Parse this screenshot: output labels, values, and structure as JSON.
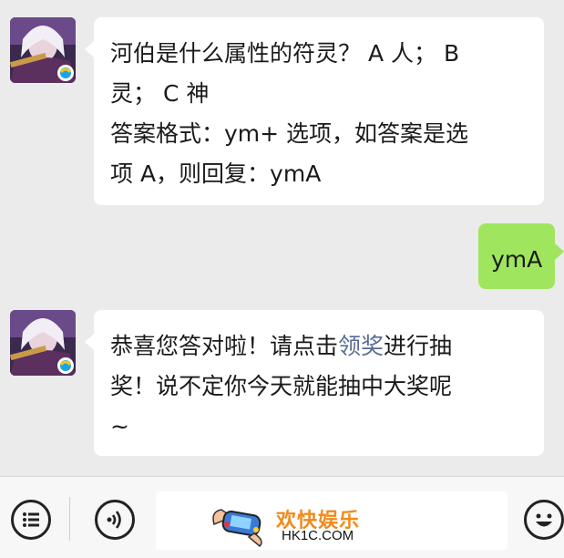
{
  "messages": [
    {
      "sender": "contact",
      "lines": [
        "河伯是什么属性的符灵？ A 人； B",
        "灵； C 神",
        "答案格式：ym+ 选项，如答案是选",
        "项 A，则回复：ymA"
      ]
    },
    {
      "sender": "me",
      "text": "ymA"
    },
    {
      "sender": "contact",
      "line1_before": "恭喜您答对啦！请点击",
      "line1_link": "领奖",
      "line1_after": "进行抽",
      "line2": "奖！说不定你今天就能抽中大奖呢",
      "line3": "~"
    }
  ],
  "toolbar": {
    "menu_icon": "list-menu-icon",
    "voice_icon": "voice-icon",
    "emoji_icon": "emoji-icon"
  },
  "watermark": {
    "title": "欢快娱乐",
    "url": "HK1C.COM"
  },
  "colors": {
    "background": "#ebebeb",
    "incoming_bubble": "#ffffff",
    "outgoing_bubble": "#9fe65e",
    "link": "#576b95",
    "watermark_title": "#f08a1c"
  }
}
